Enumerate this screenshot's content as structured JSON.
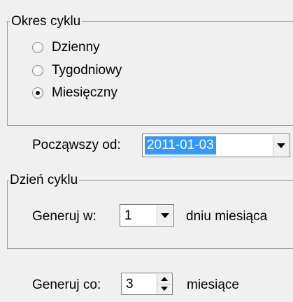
{
  "cycle_period": {
    "legend": "Okres cyklu",
    "options": [
      {
        "label": "Dzienny",
        "checked": false
      },
      {
        "label": "Tygodniowy",
        "checked": false
      },
      {
        "label": "Miesięczny",
        "checked": true
      }
    ]
  },
  "start_from": {
    "label": "Począwszy od:",
    "value": "2011-01-03"
  },
  "cycle_day": {
    "legend": "Dzień cyklu",
    "generate_on_label": "Generuj w:",
    "generate_on_value": "1",
    "generate_on_suffix": "dniu miesiąca"
  },
  "repeat": {
    "label": "Generuj co:",
    "value": "3",
    "suffix": "miesiące"
  },
  "colors": {
    "selection": "#3399ff",
    "background": "#f0f0f0"
  }
}
